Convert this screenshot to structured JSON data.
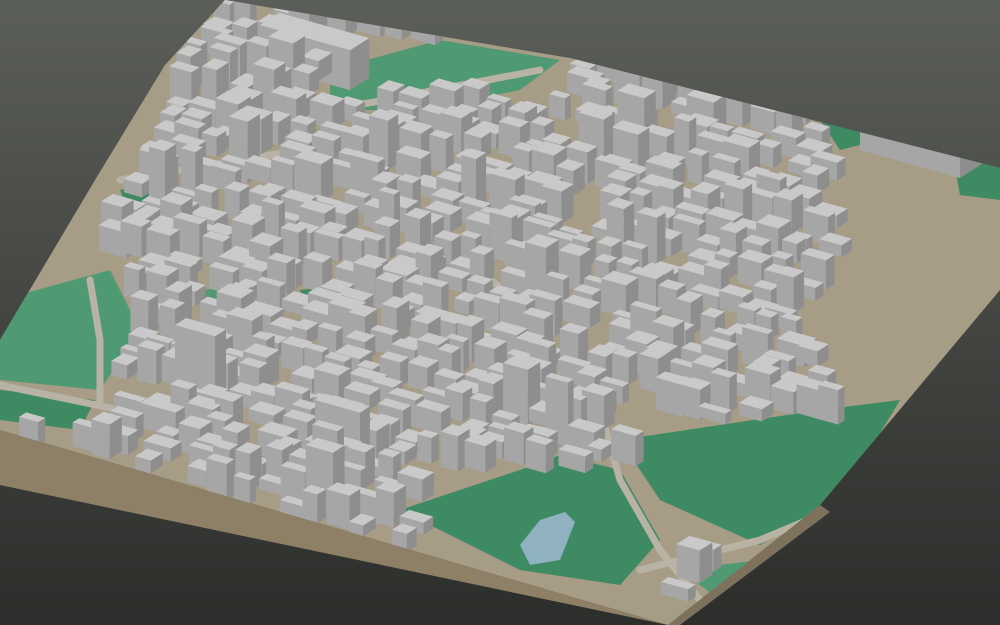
{
  "viewer": {
    "background_top": "#5b5e59",
    "background_bottom": "#2c2e2b"
  },
  "palette": {
    "building_top": "#c9c9c9",
    "building_left": "#a6a6a6",
    "building_right": "#8e8e8e",
    "ground": "#a79c86",
    "ground_edge": "#8e7f67",
    "park": "#3d8a63",
    "park_light": "#4f9a72",
    "water": "#8fb1c0",
    "road": "#b9b3a5"
  },
  "scene": {
    "kind": "3d-city-block-model",
    "description_visible": false
  }
}
